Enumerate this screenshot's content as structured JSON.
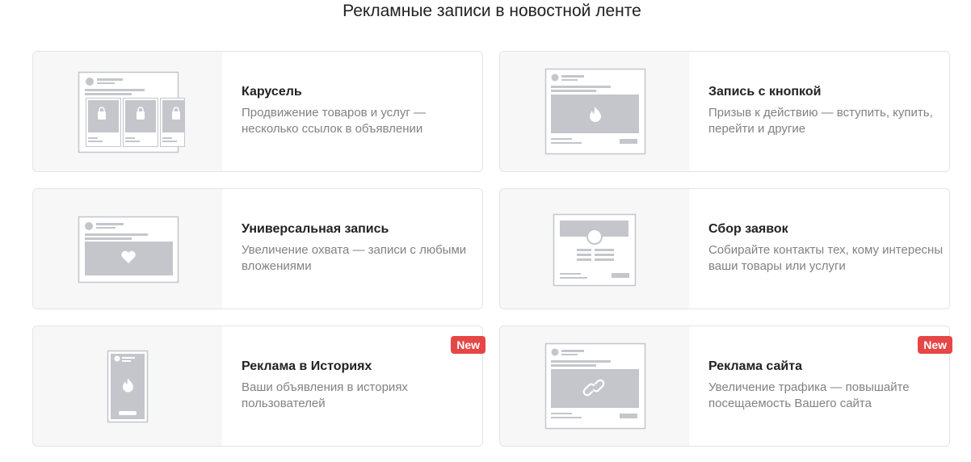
{
  "title": "Рекламные записи в новостной ленте",
  "cards": [
    {
      "title": "Карусель",
      "desc": "Продвижение товаров и услуг — несколько ссылок в объявлении",
      "icon": "carousel-icon"
    },
    {
      "title": "Запись с кнопкой",
      "desc": "Призыв к действию — вступить, купить, перейти и другие",
      "icon": "button-post-icon"
    },
    {
      "title": "Универсальная запись",
      "desc": "Увеличение охвата — записи с любыми вложениями",
      "icon": "universal-post-icon"
    },
    {
      "title": "Сбор заявок",
      "desc": "Собирайте контакты тех, кому интересны ваши товары или услуги",
      "icon": "lead-form-icon"
    },
    {
      "title": "Реклама в Историях",
      "desc": "Ваши объявления в историях пользователей",
      "icon": "stories-icon",
      "badge": "New"
    },
    {
      "title": "Реклама сайта",
      "desc": "Увеличение трафика — повышайте посещаемость Вашего сайта",
      "icon": "website-ad-icon",
      "badge": "New"
    }
  ],
  "colors": {
    "accent_badge": "#e64646",
    "illustration_gray": "#c4c6cc",
    "text_secondary": "#828282"
  }
}
